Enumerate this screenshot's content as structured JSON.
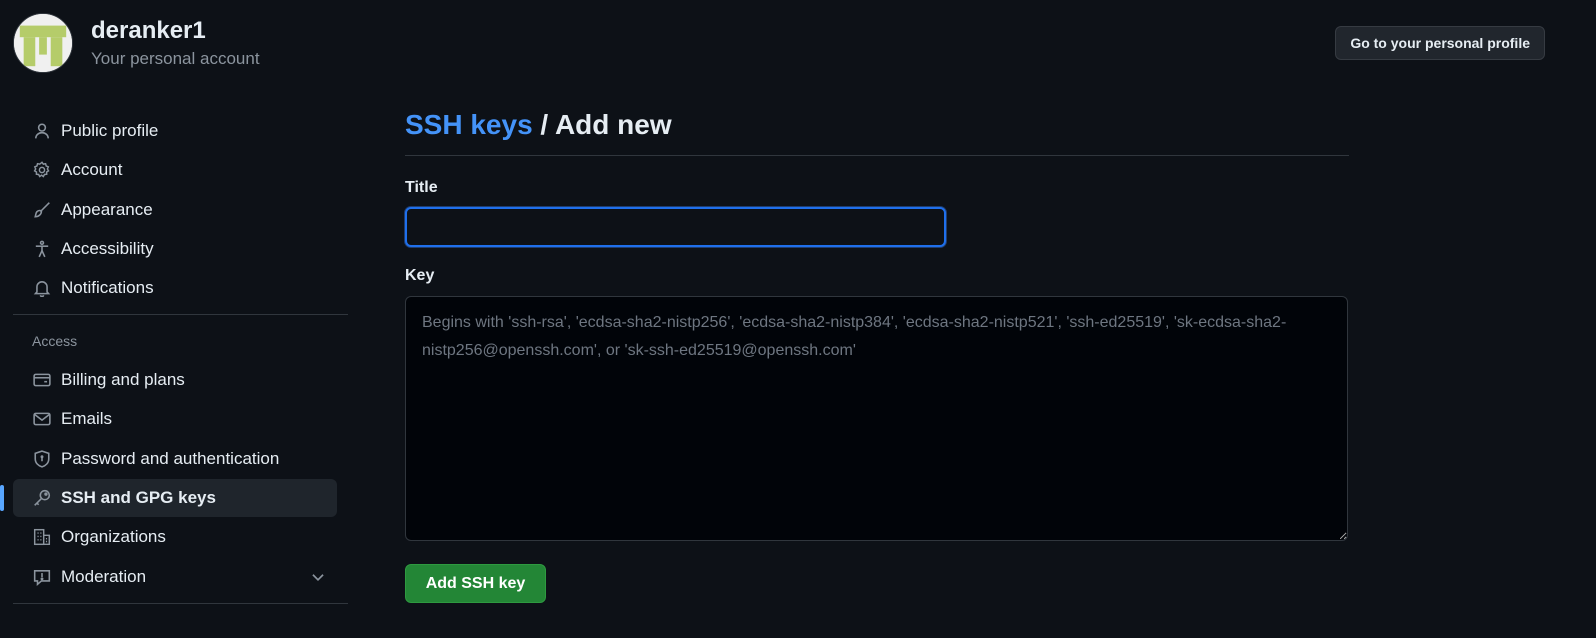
{
  "header": {
    "username": "deranker1",
    "subtitle": "Your personal account",
    "profile_button": "Go to your personal profile"
  },
  "sidebar": {
    "items": [
      {
        "label": "Public profile",
        "icon": "person-icon"
      },
      {
        "label": "Account",
        "icon": "gear-icon"
      },
      {
        "label": "Appearance",
        "icon": "paintbrush-icon"
      },
      {
        "label": "Accessibility",
        "icon": "accessibility-icon"
      },
      {
        "label": "Notifications",
        "icon": "bell-icon"
      }
    ],
    "access_title": "Access",
    "access_items": [
      {
        "label": "Billing and plans",
        "icon": "credit-card-icon"
      },
      {
        "label": "Emails",
        "icon": "mail-icon"
      },
      {
        "label": "Password and authentication",
        "icon": "shield-lock-icon"
      },
      {
        "label": "SSH and GPG keys",
        "icon": "key-icon",
        "active": true
      },
      {
        "label": "Organizations",
        "icon": "organization-icon"
      },
      {
        "label": "Moderation",
        "icon": "report-icon",
        "expandable": true
      }
    ]
  },
  "main": {
    "breadcrumb_link": "SSH keys",
    "breadcrumb_separator": " / ",
    "breadcrumb_current": "Add new",
    "title_label": "Title",
    "title_value": "",
    "key_label": "Key",
    "key_placeholder": "Begins with 'ssh-rsa', 'ecdsa-sha2-nistp256', 'ecdsa-sha2-nistp384', 'ecdsa-sha2-nistp521', 'ssh-ed25519', 'sk-ecdsa-sha2-nistp256@openssh.com', or 'sk-ssh-ed25519@openssh.com'",
    "submit_button": "Add SSH key"
  },
  "colors": {
    "background": "#0d1117",
    "link": "#4493f8",
    "active_indicator": "#58a6ff",
    "primary_button": "#238636",
    "avatar_pattern": "#b5cc6a"
  }
}
